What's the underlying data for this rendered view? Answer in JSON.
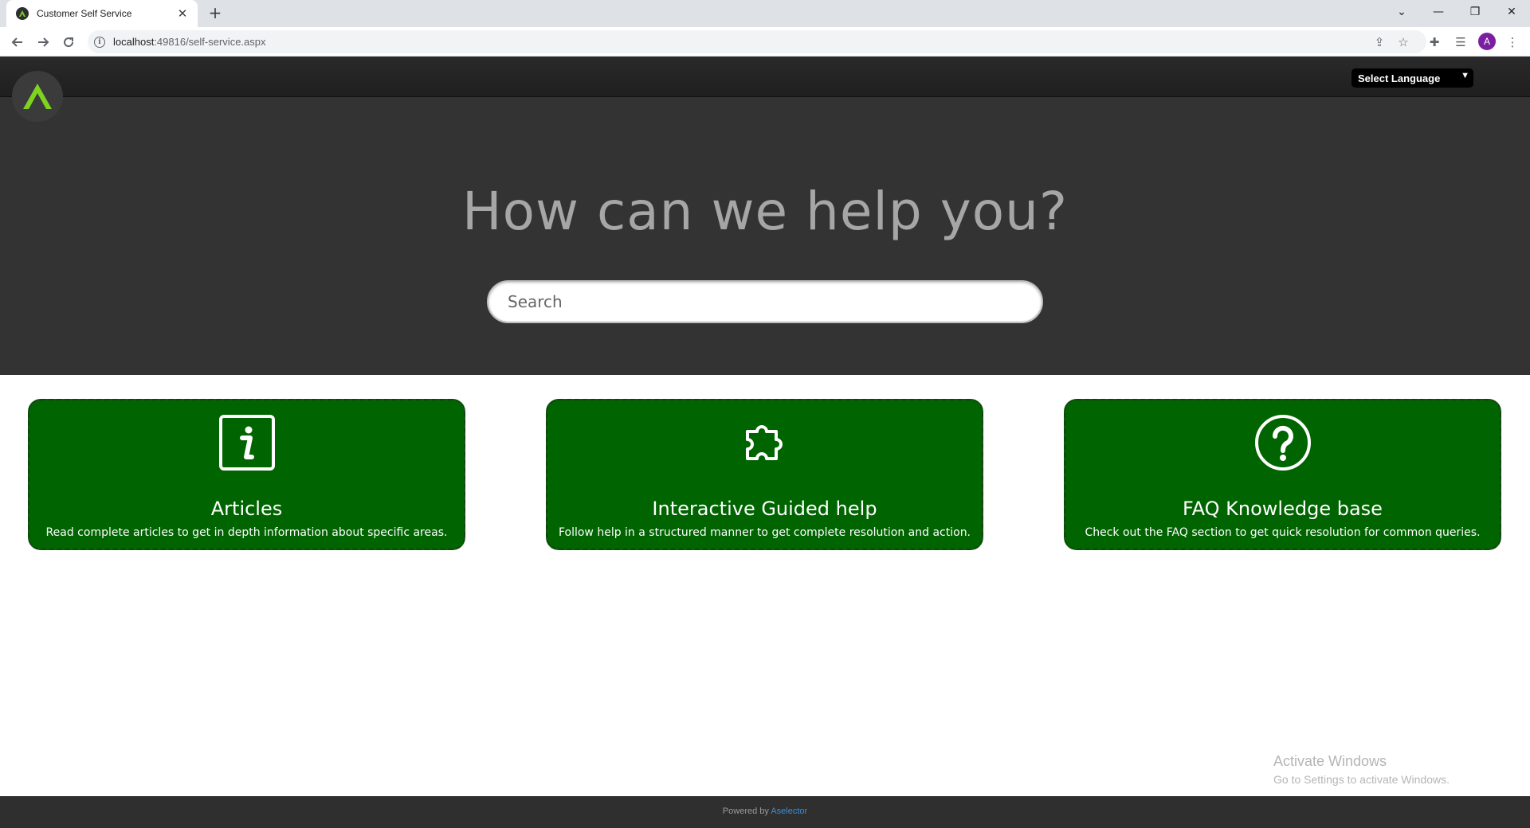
{
  "browser": {
    "tab_title": "Customer Self Service",
    "url_host": "localhost",
    "url_path": ":49816/self-service.aspx",
    "profile_initial": "A"
  },
  "header": {
    "language_select": "Select Language"
  },
  "hero": {
    "title": "How can we help you?",
    "search_placeholder": "Search"
  },
  "cards": [
    {
      "icon": "info-icon",
      "title": "Articles",
      "description": "Read complete articles to get in depth information about specific areas."
    },
    {
      "icon": "puzzle-icon",
      "title": "Interactive Guided help",
      "description": "Follow help in a structured manner to get complete resolution and action."
    },
    {
      "icon": "question-icon",
      "title": "FAQ Knowledge base",
      "description": "Check out the FAQ section to get quick resolution for common queries."
    }
  ],
  "watermark": {
    "line1": "Activate Windows",
    "line2": "Go to Settings to activate Windows."
  },
  "footer": {
    "powered_by": "Powered by",
    "brand": "Aselector"
  },
  "colors": {
    "card_green": "#006400",
    "hero_bg": "#333333",
    "logo_accent": "#7ed321",
    "link_blue": "#3a8fd6"
  }
}
